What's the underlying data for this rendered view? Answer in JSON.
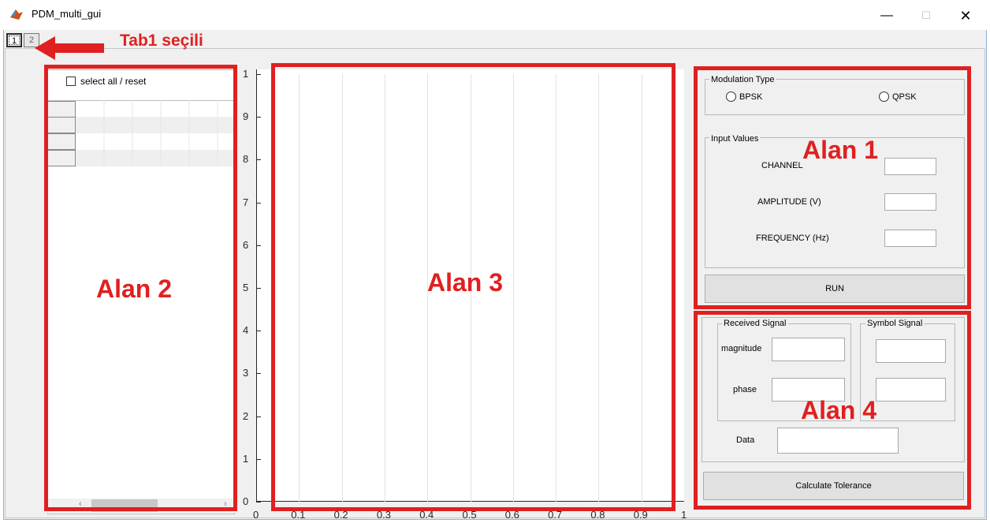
{
  "window": {
    "title": "PDM_multi_gui"
  },
  "tabs": [
    {
      "label": "1"
    },
    {
      "label": "2"
    }
  ],
  "annotations": {
    "tab_note": "Tab1 seçili",
    "alan1": "Alan 1",
    "alan2": "Alan 2",
    "alan3": "Alan 3",
    "alan4": "Alan 4"
  },
  "left_panel": {
    "select_all_label": "select all / reset"
  },
  "axes": {
    "y_ticks": [
      "1",
      "9",
      "8",
      "7",
      "6",
      "5",
      "4",
      "3",
      "2",
      "1",
      "0"
    ],
    "x_ticks": [
      "0",
      "0.1",
      "0.2",
      "0.3",
      "0.4",
      "0.5",
      "0.6",
      "0.7",
      "0.8",
      "0.9",
      "1"
    ]
  },
  "modulation": {
    "title": "Modulation Type",
    "options": [
      "BPSK",
      "QPSK"
    ]
  },
  "input_values": {
    "title": "Input Values",
    "channel_label": "CHANNEL",
    "amplitude_label": "AMPLITUDE  (V)",
    "frequency_label": "FREQUENCY (Hz)",
    "run_label": "RUN"
  },
  "received": {
    "title": "Received Signal",
    "magnitude_label": "magnitude",
    "phase_label": "phase"
  },
  "symbol": {
    "title": "Symbol Signal"
  },
  "data_label": "Data",
  "calc_label": "Calculate Tolerance",
  "colors": {
    "annotation": "#e02020",
    "panel_bg": "#f0f0f0"
  }
}
